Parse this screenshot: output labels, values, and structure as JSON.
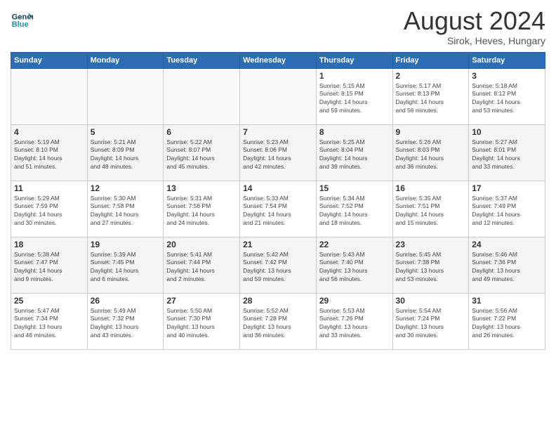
{
  "header": {
    "logo_line1": "General",
    "logo_line2": "Blue",
    "month_year": "August 2024",
    "location": "Sirok, Heves, Hungary"
  },
  "days_of_week": [
    "Sunday",
    "Monday",
    "Tuesday",
    "Wednesday",
    "Thursday",
    "Friday",
    "Saturday"
  ],
  "weeks": [
    [
      {
        "day": "",
        "info": ""
      },
      {
        "day": "",
        "info": ""
      },
      {
        "day": "",
        "info": ""
      },
      {
        "day": "",
        "info": ""
      },
      {
        "day": "1",
        "info": "Sunrise: 5:15 AM\nSunset: 8:15 PM\nDaylight: 14 hours\nand 59 minutes."
      },
      {
        "day": "2",
        "info": "Sunrise: 5:17 AM\nSunset: 8:13 PM\nDaylight: 14 hours\nand 56 minutes."
      },
      {
        "day": "3",
        "info": "Sunrise: 5:18 AM\nSunset: 8:12 PM\nDaylight: 14 hours\nand 53 minutes."
      }
    ],
    [
      {
        "day": "4",
        "info": "Sunrise: 5:19 AM\nSunset: 8:10 PM\nDaylight: 14 hours\nand 51 minutes."
      },
      {
        "day": "5",
        "info": "Sunrise: 5:21 AM\nSunset: 8:09 PM\nDaylight: 14 hours\nand 48 minutes."
      },
      {
        "day": "6",
        "info": "Sunrise: 5:22 AM\nSunset: 8:07 PM\nDaylight: 14 hours\nand 45 minutes."
      },
      {
        "day": "7",
        "info": "Sunrise: 5:23 AM\nSunset: 8:06 PM\nDaylight: 14 hours\nand 42 minutes."
      },
      {
        "day": "8",
        "info": "Sunrise: 5:25 AM\nSunset: 8:04 PM\nDaylight: 14 hours\nand 39 minutes."
      },
      {
        "day": "9",
        "info": "Sunrise: 5:26 AM\nSunset: 8:03 PM\nDaylight: 14 hours\nand 36 minutes."
      },
      {
        "day": "10",
        "info": "Sunrise: 5:27 AM\nSunset: 8:01 PM\nDaylight: 14 hours\nand 33 minutes."
      }
    ],
    [
      {
        "day": "11",
        "info": "Sunrise: 5:29 AM\nSunset: 7:59 PM\nDaylight: 14 hours\nand 30 minutes."
      },
      {
        "day": "12",
        "info": "Sunrise: 5:30 AM\nSunset: 7:58 PM\nDaylight: 14 hours\nand 27 minutes."
      },
      {
        "day": "13",
        "info": "Sunrise: 5:31 AM\nSunset: 7:56 PM\nDaylight: 14 hours\nand 24 minutes."
      },
      {
        "day": "14",
        "info": "Sunrise: 5:33 AM\nSunset: 7:54 PM\nDaylight: 14 hours\nand 21 minutes."
      },
      {
        "day": "15",
        "info": "Sunrise: 5:34 AM\nSunset: 7:52 PM\nDaylight: 14 hours\nand 18 minutes."
      },
      {
        "day": "16",
        "info": "Sunrise: 5:35 AM\nSunset: 7:51 PM\nDaylight: 14 hours\nand 15 minutes."
      },
      {
        "day": "17",
        "info": "Sunrise: 5:37 AM\nSunset: 7:49 PM\nDaylight: 14 hours\nand 12 minutes."
      }
    ],
    [
      {
        "day": "18",
        "info": "Sunrise: 5:38 AM\nSunset: 7:47 PM\nDaylight: 14 hours\nand 9 minutes."
      },
      {
        "day": "19",
        "info": "Sunrise: 5:39 AM\nSunset: 7:45 PM\nDaylight: 14 hours\nand 6 minutes."
      },
      {
        "day": "20",
        "info": "Sunrise: 5:41 AM\nSunset: 7:44 PM\nDaylight: 14 hours\nand 2 minutes."
      },
      {
        "day": "21",
        "info": "Sunrise: 5:42 AM\nSunset: 7:42 PM\nDaylight: 13 hours\nand 59 minutes."
      },
      {
        "day": "22",
        "info": "Sunrise: 5:43 AM\nSunset: 7:40 PM\nDaylight: 13 hours\nand 56 minutes."
      },
      {
        "day": "23",
        "info": "Sunrise: 5:45 AM\nSunset: 7:38 PM\nDaylight: 13 hours\nand 53 minutes."
      },
      {
        "day": "24",
        "info": "Sunrise: 5:46 AM\nSunset: 7:36 PM\nDaylight: 13 hours\nand 49 minutes."
      }
    ],
    [
      {
        "day": "25",
        "info": "Sunrise: 5:47 AM\nSunset: 7:34 PM\nDaylight: 13 hours\nand 46 minutes."
      },
      {
        "day": "26",
        "info": "Sunrise: 5:49 AM\nSunset: 7:32 PM\nDaylight: 13 hours\nand 43 minutes."
      },
      {
        "day": "27",
        "info": "Sunrise: 5:50 AM\nSunset: 7:30 PM\nDaylight: 13 hours\nand 40 minutes."
      },
      {
        "day": "28",
        "info": "Sunrise: 5:52 AM\nSunset: 7:28 PM\nDaylight: 13 hours\nand 36 minutes."
      },
      {
        "day": "29",
        "info": "Sunrise: 5:53 AM\nSunset: 7:26 PM\nDaylight: 13 hours\nand 33 minutes."
      },
      {
        "day": "30",
        "info": "Sunrise: 5:54 AM\nSunset: 7:24 PM\nDaylight: 13 hours\nand 30 minutes."
      },
      {
        "day": "31",
        "info": "Sunrise: 5:56 AM\nSunset: 7:22 PM\nDaylight: 13 hours\nand 26 minutes."
      }
    ]
  ]
}
